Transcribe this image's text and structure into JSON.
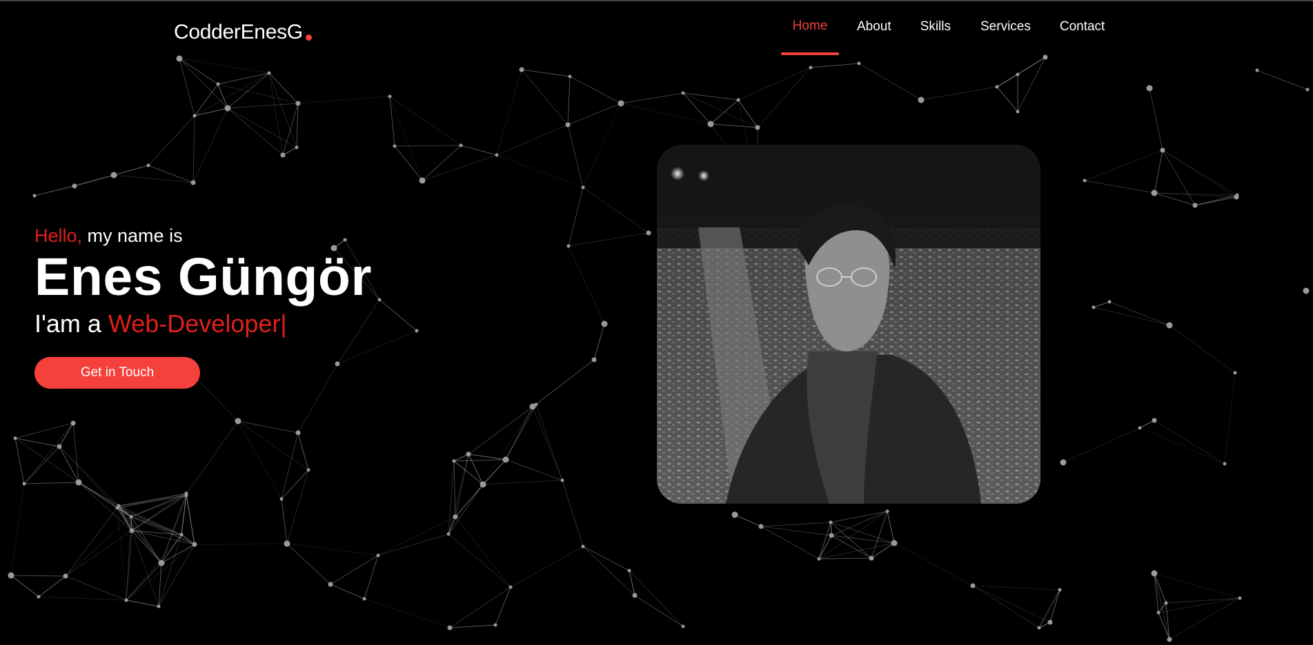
{
  "header": {
    "logo_text": "CodderEnesG",
    "nav": [
      {
        "label": "Home",
        "active": true
      },
      {
        "label": "About",
        "active": false
      },
      {
        "label": "Skills",
        "active": false
      },
      {
        "label": "Services",
        "active": false
      },
      {
        "label": "Contact",
        "active": false
      }
    ]
  },
  "hero": {
    "greeting_highlight": "Hello,",
    "greeting_rest": " my name is",
    "name": "Enes Güngör",
    "role_prefix": "I'am a ",
    "role_highlight": "Web-Developer|",
    "cta_label": "Get in Touch"
  },
  "colors": {
    "accent": "#f5413b",
    "highlight_text": "#e0201b",
    "background": "#000000"
  }
}
